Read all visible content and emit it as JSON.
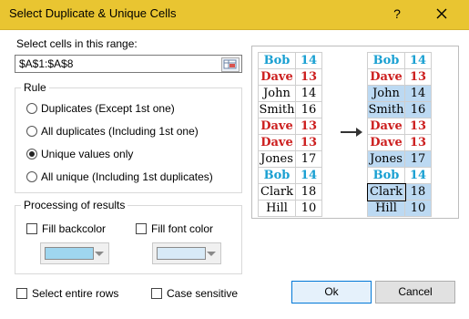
{
  "window": {
    "title": "Select Duplicate & Unique Cells",
    "help": "?"
  },
  "range": {
    "label": "Select cells in this range:",
    "value": "$A$1:$A$8"
  },
  "rule": {
    "legend": "Rule",
    "options": [
      {
        "label": "Duplicates (Except 1st one)",
        "checked": false
      },
      {
        "label": "All duplicates (Including 1st one)",
        "checked": false
      },
      {
        "label": "Unique values only",
        "checked": true
      },
      {
        "label": "All unique (Including 1st duplicates)",
        "checked": false
      }
    ]
  },
  "processing": {
    "legend": "Processing of results",
    "fill_backcolor_label": "Fill backcolor",
    "fill_font_color_label": "Fill font color",
    "backcolor": "#9fd6ef",
    "fontcolor": "#d8eaf7"
  },
  "preview": {
    "before": [
      {
        "name": "Bob",
        "value": "14",
        "style": "blue"
      },
      {
        "name": "Dave",
        "value": "13",
        "style": "red"
      },
      {
        "name": "John",
        "value": "14",
        "style": "plain"
      },
      {
        "name": "Smith",
        "value": "16",
        "style": "plain"
      },
      {
        "name": "Dave",
        "value": "13",
        "style": "red"
      },
      {
        "name": "Dave",
        "value": "13",
        "style": "red"
      },
      {
        "name": "Jones",
        "value": "17",
        "style": "plain"
      },
      {
        "name": "Bob",
        "value": "14",
        "style": "blue"
      },
      {
        "name": "Clark",
        "value": "18",
        "style": "plain"
      },
      {
        "name": "Hill",
        "value": "10",
        "style": "plain"
      }
    ],
    "after": [
      {
        "name": "Bob",
        "value": "14",
        "style": "blue"
      },
      {
        "name": "Dave",
        "value": "13",
        "style": "red"
      },
      {
        "name": "John",
        "value": "14",
        "style": "hl"
      },
      {
        "name": "Smith",
        "value": "16",
        "style": "hl"
      },
      {
        "name": "Dave",
        "value": "13",
        "style": "red"
      },
      {
        "name": "Dave",
        "value": "13",
        "style": "red"
      },
      {
        "name": "Jones",
        "value": "17",
        "style": "hl"
      },
      {
        "name": "Bob",
        "value": "14",
        "style": "blue"
      },
      {
        "name": "Clark",
        "value": "18",
        "style": "hl"
      },
      {
        "name": "Hill",
        "value": "10",
        "style": "hl"
      }
    ]
  },
  "options": {
    "select_entire_rows": "Select entire rows",
    "case_sensitive": "Case sensitive"
  },
  "buttons": {
    "ok": "Ok",
    "cancel": "Cancel"
  }
}
